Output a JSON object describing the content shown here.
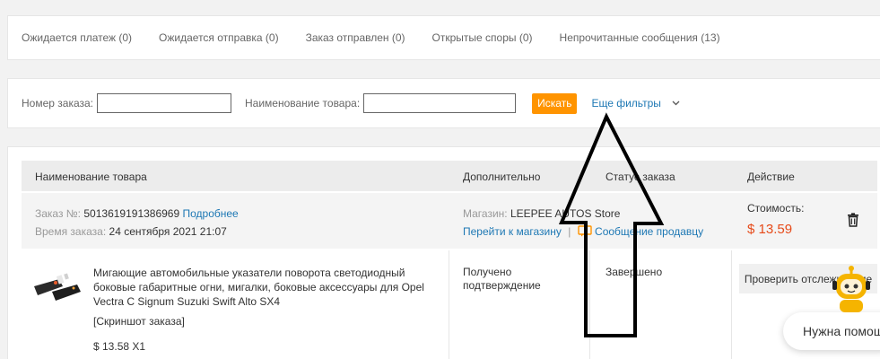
{
  "status_tabs": [
    {
      "label": "Ожидается платеж (0)"
    },
    {
      "label": "Ожидается отправка (0)"
    },
    {
      "label": "Заказ отправлен (0)"
    },
    {
      "label": "Открытые споры (0)"
    },
    {
      "label": "Непрочитанные сообщения (13)"
    }
  ],
  "filters": {
    "order_number_label": "Номер заказа:",
    "order_number_value": "",
    "product_name_label": "Наименование товара:",
    "product_name_value": "",
    "search_button": "Искать",
    "more_filters": "Еще фильтры"
  },
  "table": {
    "headers": {
      "product": "Наименование товара",
      "extra": "Дополнительно",
      "status": "Статус заказа",
      "action": "Действие"
    },
    "order": {
      "order_no_label": "Заказ №:",
      "order_no": "5013619191386969",
      "details_link": "Подробнее",
      "order_time_label": "Время заказа:",
      "order_time": "24 сентября 2021 21:07",
      "store_label": "Магазин:",
      "store_name": "LEEPEE AUTOS Store",
      "go_to_store": "Перейти к магазину",
      "message_seller": "Сообщение продавцу",
      "cost_label": "Стоимость:",
      "cost": "$ 13.59"
    },
    "item": {
      "title": "Мигающие автомобильные указатели поворота светодиодный боковые габаритные огни, мигалки, боковые аксессуары для Opel Vectra C Signum Suzuki Swift Alto SX4",
      "snapshot": "[Скриншот заказа]",
      "unit_price": "$ 13.58 X1",
      "extra_info": "Получено подтверждение",
      "status": "Завершено",
      "track_button": "Проверить отслеживание"
    }
  },
  "help": {
    "label": "Нужна помощь?"
  },
  "colors": {
    "accent_orange": "#ff9400",
    "price_red": "#e64a19",
    "link_blue": "#1e78b4"
  }
}
